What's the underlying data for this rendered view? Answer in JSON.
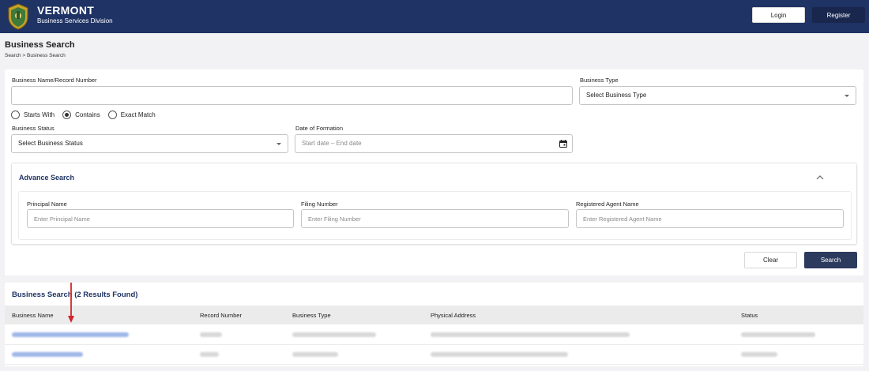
{
  "header": {
    "brand_title": "VERMONT",
    "brand_subtitle": "Business Services Division",
    "login_label": "Login",
    "register_label": "Register",
    "bg_color": "#1f3364"
  },
  "page": {
    "title": "Business Search",
    "breadcrumb": "Search > Business Search"
  },
  "search": {
    "name_label": "Business Name/Record Number",
    "name_value": "",
    "match_options": [
      "Starts With",
      "Contains",
      "Exact Match"
    ],
    "selected_match": "Contains",
    "type_label": "Business Type",
    "type_value": "Select Business Type",
    "status_label": "Business Status",
    "status_value": "Select Business Status",
    "date_label": "Date of Formation",
    "date_placeholder": "Start date – End date"
  },
  "advance": {
    "title": "Advance Search",
    "principal_label": "Principal Name",
    "principal_placeholder": "Enter Principal Name",
    "filing_label": "Filing Number",
    "filing_placeholder": "Enter Filing Number",
    "agent_label": "Registered Agent Name",
    "agent_placeholder": "Enter Registered Agent Name"
  },
  "actions": {
    "clear_label": "Clear",
    "search_label": "Search"
  },
  "results": {
    "title": "Business Search (2 Results Found)",
    "columns": [
      "Business Name",
      "Record Number",
      "Business Type",
      "Physical Address",
      "Status"
    ],
    "rows_redacted": 2
  }
}
